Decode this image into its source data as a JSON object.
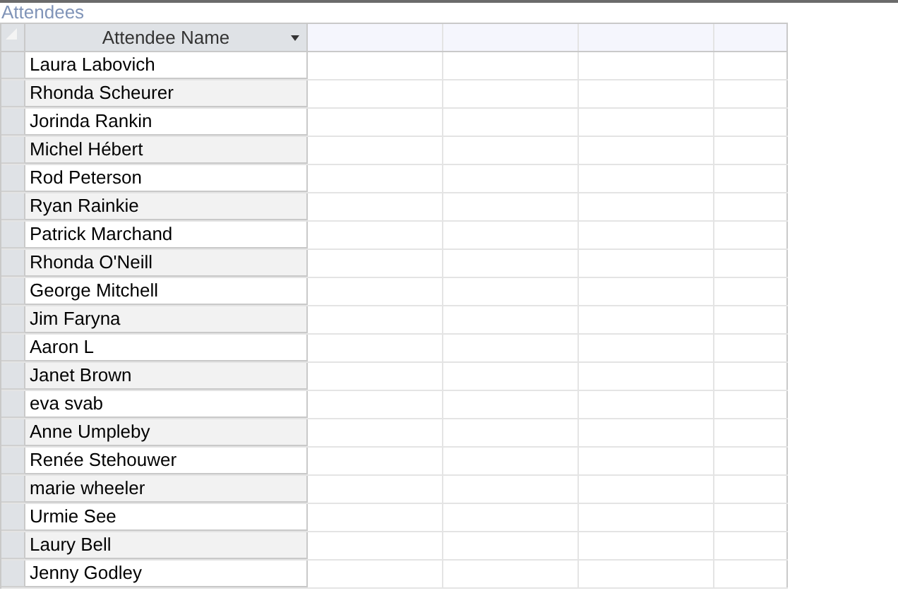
{
  "title": "Attendees",
  "table": {
    "columns": [
      {
        "label": "Attendee Name"
      }
    ],
    "rows": [
      {
        "name": "Laura Labovich"
      },
      {
        "name": "Rhonda Scheurer"
      },
      {
        "name": "Jorinda Rankin"
      },
      {
        "name": "Michel Hébert"
      },
      {
        "name": "Rod Peterson"
      },
      {
        "name": "Ryan Rainkie"
      },
      {
        "name": "Patrick Marchand"
      },
      {
        "name": "Rhonda O'Neill"
      },
      {
        "name": "George Mitchell"
      },
      {
        "name": "Jim Faryna"
      },
      {
        "name": "Aaron L"
      },
      {
        "name": "Janet Brown"
      },
      {
        "name": "eva svab"
      },
      {
        "name": "Anne Umpleby"
      },
      {
        "name": "Renée Stehouwer"
      },
      {
        "name": "marie wheeler"
      },
      {
        "name": "Urmie See"
      },
      {
        "name": "Laury Bell"
      },
      {
        "name": "Jenny Godley"
      }
    ]
  }
}
